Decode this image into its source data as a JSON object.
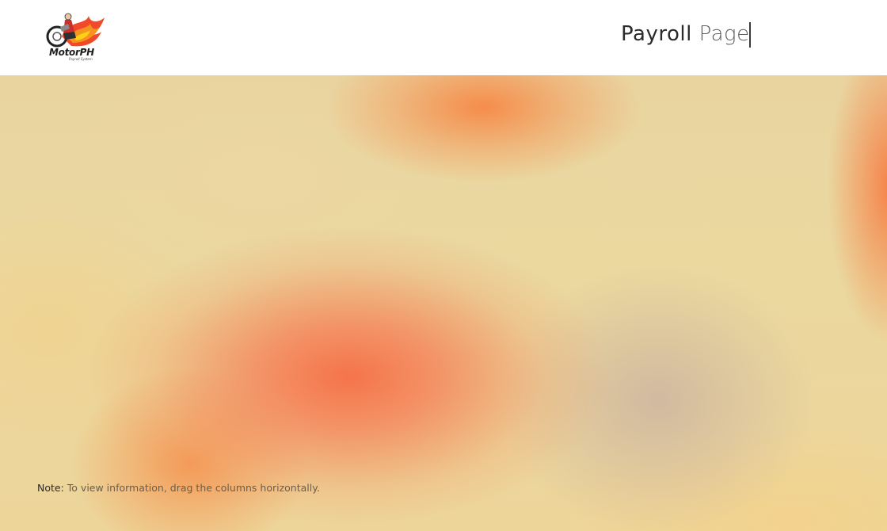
{
  "header": {
    "logo": {
      "wordmark": "MotorPH",
      "tagline": "Payroll System",
      "icon": "motorcycle-rider-flame-logo"
    },
    "title_strong": "Payroll",
    "title_light": "Page"
  },
  "note": {
    "label": "Note:",
    "text": "To view information, drag the columns horizontally."
  },
  "colors": {
    "accent_orange": "#f6784a",
    "background_cream": "#ead89f",
    "header_bg": "#ffffff"
  }
}
